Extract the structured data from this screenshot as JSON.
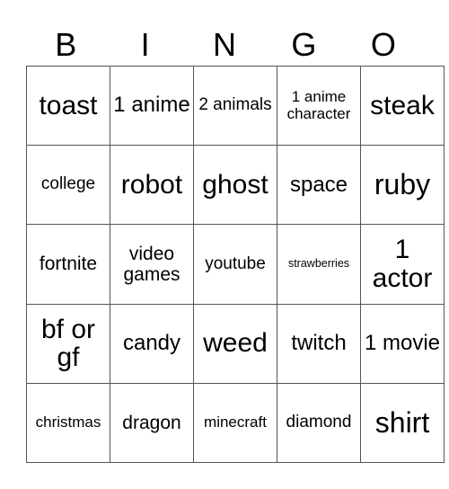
{
  "header": [
    "B",
    "I",
    "N",
    "G",
    "O"
  ],
  "rows": [
    [
      "toast",
      "1 anime",
      "2 animals",
      "1 anime character",
      "steak"
    ],
    [
      "college",
      "robot",
      "ghost",
      "space",
      "ruby"
    ],
    [
      "fortnite",
      "video games",
      "youtube",
      "strawberries",
      "1 actor"
    ],
    [
      "bf or gf",
      "candy",
      "weed",
      "twitch",
      "1 movie"
    ],
    [
      "christmas",
      "dragon",
      "minecraft",
      "diamond",
      "shirt"
    ]
  ]
}
